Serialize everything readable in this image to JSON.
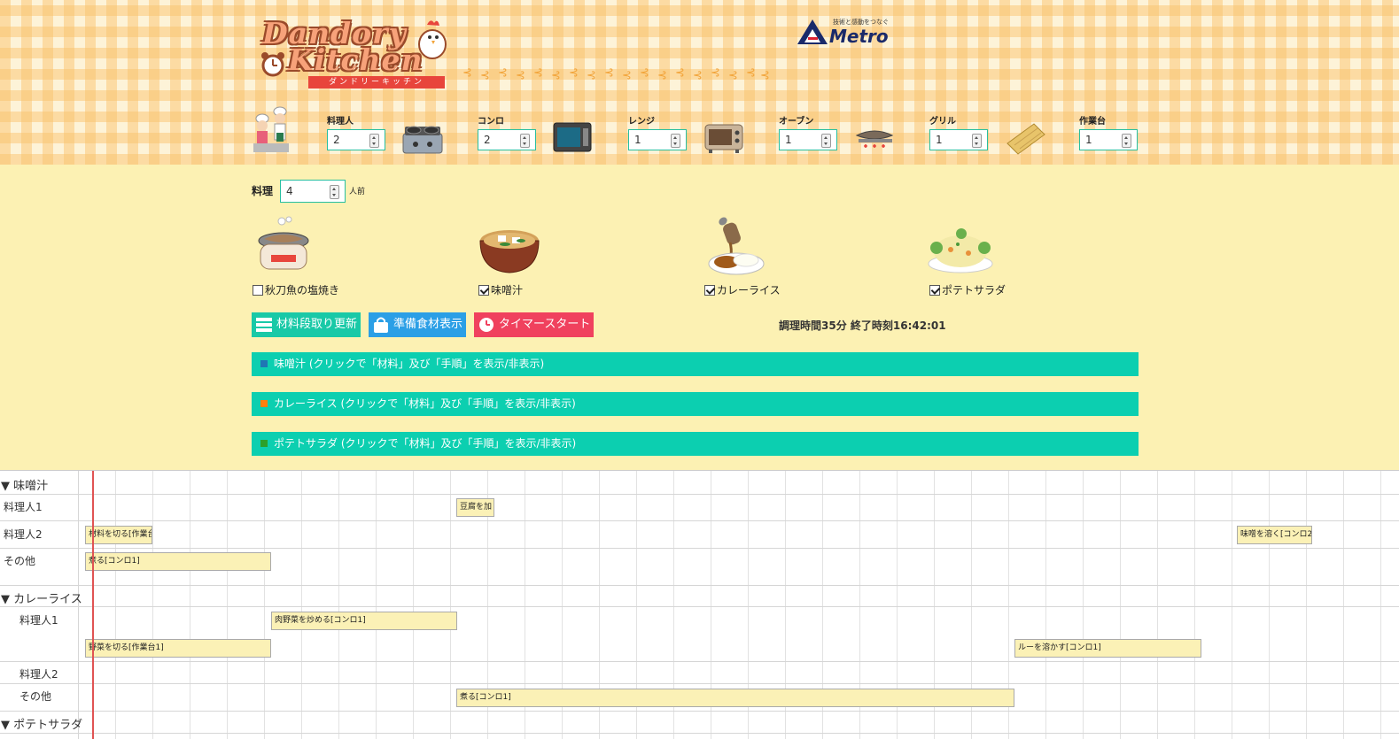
{
  "header": {
    "logo_line1": "Dandory",
    "logo_line2": "Kitchen",
    "logo_sub": "ダンドリーキッチン",
    "brand_tagline": "技術と感動をつなぐ",
    "brand_name": "Metro",
    "equipment": [
      {
        "label": "料理人",
        "value": "2",
        "icon": "chefs-icon"
      },
      {
        "label": "コンロ",
        "value": "2",
        "icon": "gas-stove-icon"
      },
      {
        "label": "レンジ",
        "value": "1",
        "icon": "microwave-icon"
      },
      {
        "label": "オーブン",
        "value": "1",
        "icon": "toaster-oven-icon"
      },
      {
        "label": "グリル",
        "value": "1",
        "icon": "fish-grill-icon"
      },
      {
        "label": "作業台",
        "value": "1",
        "icon": "cutting-board-icon"
      }
    ]
  },
  "config": {
    "servings_label": "料理",
    "servings_value": "4",
    "servings_unit": "人前",
    "dishes": [
      {
        "name": "秋刀魚の塩焼き",
        "checked": false,
        "icon": "grilled-fish-icon"
      },
      {
        "name": "味噌汁",
        "checked": true,
        "icon": "miso-soup-icon"
      },
      {
        "name": "カレーライス",
        "checked": true,
        "icon": "curry-rice-icon"
      },
      {
        "name": "ポテトサラダ",
        "checked": true,
        "icon": "potato-salad-icon"
      }
    ],
    "buttons": {
      "update": "材料段取り更新",
      "show_ingredients": "準備食材表示",
      "timer_start": "タイマースタート"
    },
    "summary": "調理時間35分 終了時刻16:42:01",
    "accordions": [
      {
        "label": "味噌汁 (クリックで「材料」及び「手順」を表示/非表示)",
        "color": "#1f77b4"
      },
      {
        "label": "カレーライス (クリックで「材料」及び「手順」を表示/非表示)",
        "color": "#ff7f0e"
      },
      {
        "label": "ポテトサラダ (クリックで「材料」及び「手順」を表示/非表示)",
        "color": "#2ca02c"
      }
    ]
  },
  "timeline": {
    "groups": {
      "miso": "▼ 味噌汁",
      "curry": "▼ カレーライス",
      "salad": "▼ ポテトサラダ"
    },
    "rows": {
      "miso_cook1": "料理人1",
      "miso_cook2": "料理人2",
      "miso_other": "その他",
      "curry_cook1": "料理人1",
      "curry_cook2": "料理人2",
      "curry_other": "その他"
    },
    "tasks": {
      "tofu": "豆腐を加",
      "cut_ingredients": "材料を切る[作業台",
      "dissolve_miso": "味噌を溶く[コンロ2",
      "boil_miso": "煮る[コンロ1]",
      "stir_fry": "肉野菜を炒める[コンロ1]",
      "cut_vegetables": "野菜を切る[作業台1]",
      "melt_roux": "ルーを溶かす[コンロ1]",
      "boil_curry": "煮る[コンロ1]"
    }
  }
}
